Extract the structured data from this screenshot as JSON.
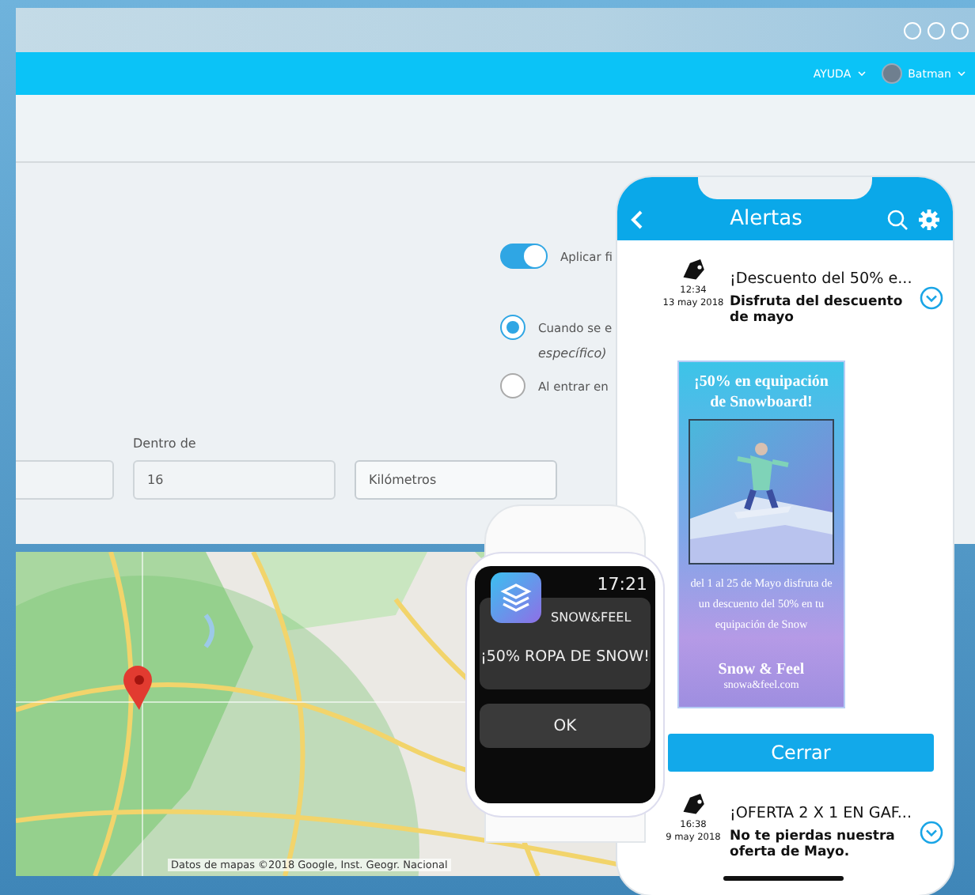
{
  "window": {
    "nav": [
      {
        "label": "AYUDA",
        "kind": "menu"
      },
      {
        "label": "Batman",
        "kind": "user"
      }
    ]
  },
  "form": {
    "toggle": {
      "label": "Aplicar fi",
      "on": true
    },
    "radios": [
      {
        "label": "Cuando se e",
        "note": "específico)",
        "selected": true
      },
      {
        "label": "Al entrar en",
        "selected": false
      }
    ],
    "fields": [
      {
        "kind": "input"
      },
      {
        "kind": "input",
        "label": "Dentro de",
        "value": "16"
      },
      {
        "kind": "select",
        "value": "Kilómetros"
      }
    ]
  },
  "map": {
    "kind": "picture",
    "attribution": "Datos de mapas ©2018 Google, Inst. Geogr. Nacional"
  },
  "phone": {
    "title": "Alertas",
    "alerts": [
      {
        "title": "¡Descuento del 50% e...",
        "body": "Disfruta del descuento de mayo",
        "time": "12:34",
        "date": "13 may 2018",
        "promo": {
          "heading": "¡50% en equipación de Snowboard!",
          "text": "del 1 al 25 de Mayo disfruta de un descuento del 50% en tu equipación de Snow",
          "brand": "Snow & Feel",
          "url": "snowa&feel.com"
        },
        "button": "Cerrar"
      },
      {
        "title": "¡OFERTA 2 X 1 EN GAF...",
        "body": "No te pierdas nuestra oferta de Mayo.",
        "time": "16:38",
        "date": "9 may 2018"
      }
    ]
  },
  "watch": {
    "time": "17:21",
    "app": "SNOW&FEEL",
    "message": "¡50% ROPA DE SNOW!",
    "button": "OK"
  }
}
